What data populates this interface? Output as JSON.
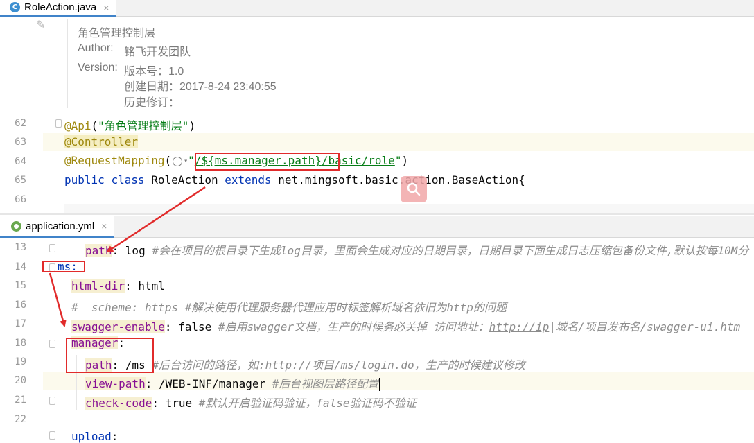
{
  "editor_top": {
    "tab": {
      "label": "RoleAction.java",
      "close": "×",
      "icon": "java-class-icon"
    },
    "doc_comment": {
      "title": "角色管理控制层",
      "author_label": "Author:",
      "author": "铭飞开发团队",
      "version_label": "Version:",
      "version": "版本号：1.0",
      "created": "创建日期：2017-8-24 23:40:55",
      "history": "历史修订："
    },
    "line_numbers": [
      "62",
      "63",
      "64",
      "65",
      "66"
    ],
    "lines": {
      "l62_ann": "@Api",
      "l62_open": "(",
      "l62_str": "\"角色管理控制层\"",
      "l62_close": ")",
      "l63_ann": "@Controller",
      "l64_ann": "@RequestMapping",
      "l64_open": "(",
      "l64_str_a": "\"",
      "l64_str_b": "/${ms.manager.path}",
      "l64_str_c": "/basic/role",
      "l64_str_d": "\"",
      "l64_close": ")",
      "l65_kw1": "public",
      "l65_kw2": "class",
      "l65_name": "RoleAction",
      "l65_kw3": "extends",
      "l65_base": "net.mingsoft.basic.action.BaseAction{"
    }
  },
  "editor_bottom": {
    "tab": {
      "label": "application.yml",
      "close": "×",
      "icon": "yaml-file-icon"
    },
    "line_numbers": [
      "13",
      "14",
      "15",
      "16",
      "17",
      "18",
      "19",
      "20",
      "21",
      "22"
    ],
    "lines": {
      "l13_key": "path",
      "l13_val": ": log ",
      "l13_cmt": "#会在项目的根目录下生成log目录，里面会生成对应的日期目录，日期目录下面生成日志压缩包备份文件,默认按每10M分",
      "l14_key": "ms:",
      "l15_key": "html-dir",
      "l15_val": ": html",
      "l16_cmt": "#  scheme: https #解决使用代理服务器代理应用时标签解析域名依旧为http的问题",
      "l17_key": "swagger-enable",
      "l17_val": ": false ",
      "l17_cmt_a": "#启用swagger文档，生产的时候务必关掉 访问地址：",
      "l17_cmt_link": "http://ip",
      "l17_cmt_b": "|域名/项目发布名/swagger-ui.htm",
      "l18_key": "manager",
      "l18_val": ":",
      "l19_key": "path",
      "l19_val": ": /ms ",
      "l19_cmt": "#后台访问的路径，如:http://项目/ms/login.do，生产的时候建议修改",
      "l20_key": "view-path",
      "l20_val": ": /WEB-INF/manager ",
      "l20_cmt": "#后台视图层路径配置",
      "l21_key": "check-code",
      "l21_val": ": true ",
      "l21_cmt": "#默认开启验证码验证，false验证码不验证",
      "l23_key": "upload",
      "l23_val": ":"
    }
  },
  "colors": {
    "highlight_box": "#e12b2b",
    "annotation": "#9e880d",
    "string": "#067d17",
    "keyword": "#0033b3",
    "yaml_key": "#871094",
    "comment": "#8c8c8c"
  }
}
